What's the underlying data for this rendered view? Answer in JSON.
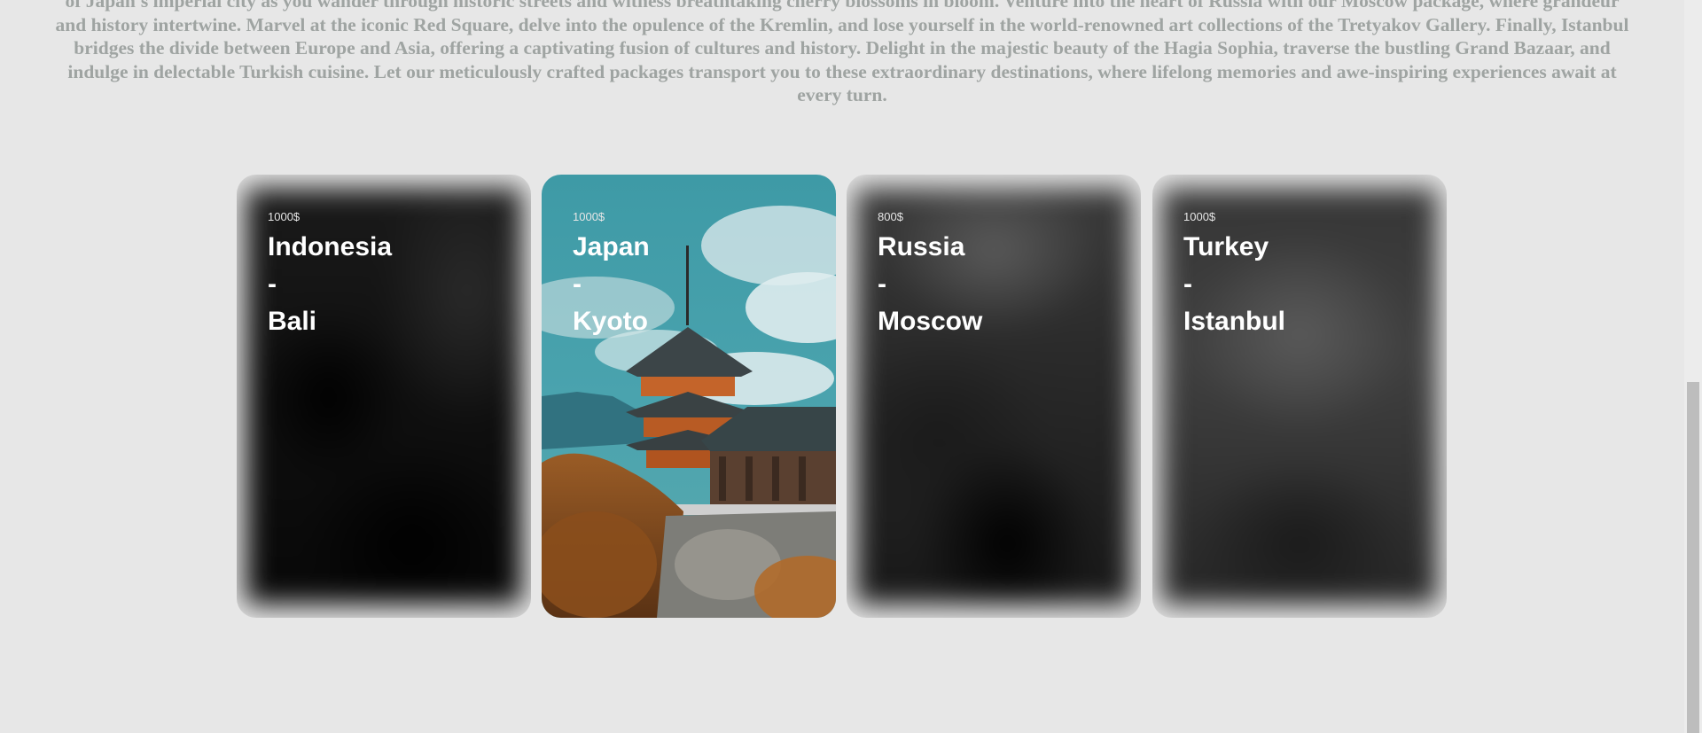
{
  "intro": {
    "lines": [
      "of Japan's imperial city as you wander through historic streets and witness breathtaking cherry blossoms in bloom. Venture into the heart of Russia with our Moscow package, where grandeur",
      "and history intertwine. Marvel at the iconic Red Square, delve into the opulence of the Kremlin, and lose yourself in the world-renowned art collections of the Tretyakov Gallery. Finally, Istanbul",
      "bridges the divide between Europe and Asia, offering a captivating fusion of cultures and history. Delight in the majestic beauty of the Hagia Sophia, traverse the bustling Grand Bazaar, and",
      "indulge in delectable Turkish cuisine. Let our meticulously crafted packages transport you to these extraordinary destinations, where lifelong memories and awe-inspiring experiences await at",
      "every turn."
    ]
  },
  "cards": [
    {
      "price": "1000$",
      "country": "Indonesia",
      "dash": "-",
      "city": "Bali",
      "active": false
    },
    {
      "price": "1000$",
      "country": "Japan",
      "dash": "-",
      "city": "Kyoto",
      "active": true
    },
    {
      "price": "800$",
      "country": "Russia",
      "dash": "-",
      "city": "Moscow",
      "active": false
    },
    {
      "price": "1000$",
      "country": "Turkey",
      "dash": "-",
      "city": "Istanbul",
      "active": false
    }
  ],
  "colors": {
    "page_bg": "#e7e7e7",
    "intro_text": "#9fa4a2",
    "card_text": "#ffffff",
    "sky": "#4a9fab"
  },
  "icons": {
    "japan_card_image": "pagoda-image"
  }
}
